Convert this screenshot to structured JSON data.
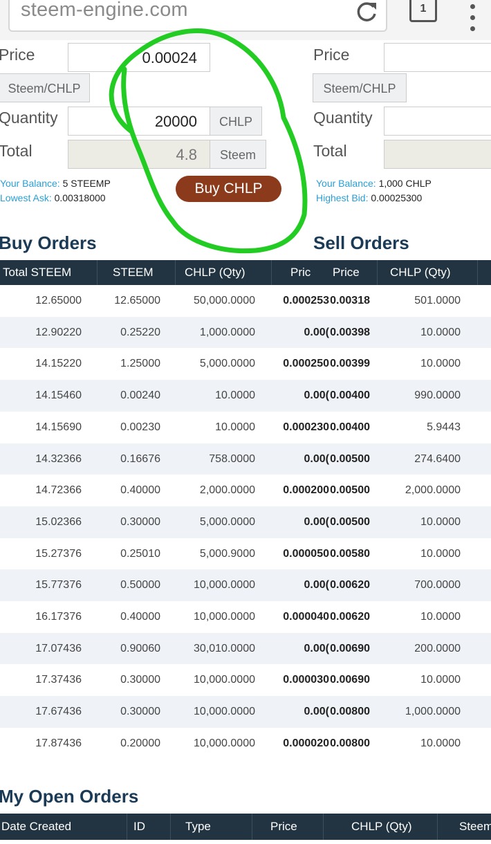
{
  "browser": {
    "url": "steem-engine.com",
    "tab_count": "1"
  },
  "buy_form": {
    "price_label": "Price",
    "price_value": "0.00024",
    "pair_label": "Steem/CHLP",
    "quantity_label": "Quantity",
    "quantity_value": "20000",
    "quantity_unit": "CHLP",
    "total_label": "Total",
    "total_value": "4.8",
    "total_unit": "Steem",
    "balance_label": "Your Balance:",
    "balance_value": "5 STEEMP",
    "lowest_ask_label": "Lowest Ask:",
    "lowest_ask_value": "0.00318000",
    "button_label": "Buy CHLP"
  },
  "sell_form": {
    "price_label": "Price",
    "pair_label": "Steem/CHLP",
    "quantity_label": "Quantity",
    "total_label": "Total",
    "balance_label": "Your Balance:",
    "balance_value": "1,000 CHLP",
    "highest_bid_label": "Highest Bid:",
    "highest_bid_value": "0.00025300"
  },
  "buy_orders": {
    "title": "Buy Orders",
    "columns": [
      "Total STEEM",
      "STEEM",
      "CHLP (Qty)",
      "Pric"
    ],
    "rows": [
      [
        "12.65000",
        "12.65000",
        "50,000.0000",
        "0.000253"
      ],
      [
        "12.90220",
        "0.25220",
        "1,000.0000",
        "0.00("
      ],
      [
        "14.15220",
        "1.25000",
        "5,000.0000",
        "0.000250"
      ],
      [
        "14.15460",
        "0.00240",
        "10.0000",
        "0.00("
      ],
      [
        "14.15690",
        "0.00230",
        "10.0000",
        "0.000230"
      ],
      [
        "14.32366",
        "0.16676",
        "758.0000",
        "0.00("
      ],
      [
        "14.72366",
        "0.40000",
        "2,000.0000",
        "0.000200"
      ],
      [
        "15.02366",
        "0.30000",
        "5,000.0000",
        "0.00("
      ],
      [
        "15.27376",
        "0.25010",
        "5,000.9000",
        "0.000050"
      ],
      [
        "15.77376",
        "0.50000",
        "10,000.0000",
        "0.00("
      ],
      [
        "16.17376",
        "0.40000",
        "10,000.0000",
        "0.000040"
      ],
      [
        "17.07436",
        "0.90060",
        "30,010.0000",
        "0.00("
      ],
      [
        "17.37436",
        "0.30000",
        "10,000.0000",
        "0.000030"
      ],
      [
        "17.67436",
        "0.30000",
        "10,000.0000",
        "0.00("
      ],
      [
        "17.87436",
        "0.20000",
        "10,000.0000",
        "0.000020"
      ]
    ]
  },
  "sell_orders": {
    "title": "Sell Orders",
    "columns": [
      "Price",
      "CHLP (Qty)"
    ],
    "rows": [
      [
        "0.00318",
        "501.0000"
      ],
      [
        "0.00398",
        "10.0000"
      ],
      [
        "0.00399",
        "10.0000"
      ],
      [
        "0.00400",
        "990.0000"
      ],
      [
        "0.00400",
        "5.9443"
      ],
      [
        "0.00500",
        "274.6400"
      ],
      [
        "0.00500",
        "2,000.0000"
      ],
      [
        "0.00500",
        "10.0000"
      ],
      [
        "0.00580",
        "10.0000"
      ],
      [
        "0.00620",
        "700.0000"
      ],
      [
        "0.00620",
        "10.0000"
      ],
      [
        "0.00690",
        "200.0000"
      ],
      [
        "0.00690",
        "10.0000"
      ],
      [
        "0.00800",
        "1,000.0000"
      ],
      [
        "0.00800",
        "10.0000"
      ]
    ]
  },
  "open_orders": {
    "title": "My Open Orders",
    "columns": [
      "Date Created",
      "ID",
      "Type",
      "Price",
      "CHLP (Qty)",
      "Steem"
    ]
  },
  "colors": {
    "header_bg": "#223441",
    "link_blue": "#2a9fd6",
    "buy_button": "#8b3a1c",
    "annotation_green": "#22cc22"
  }
}
